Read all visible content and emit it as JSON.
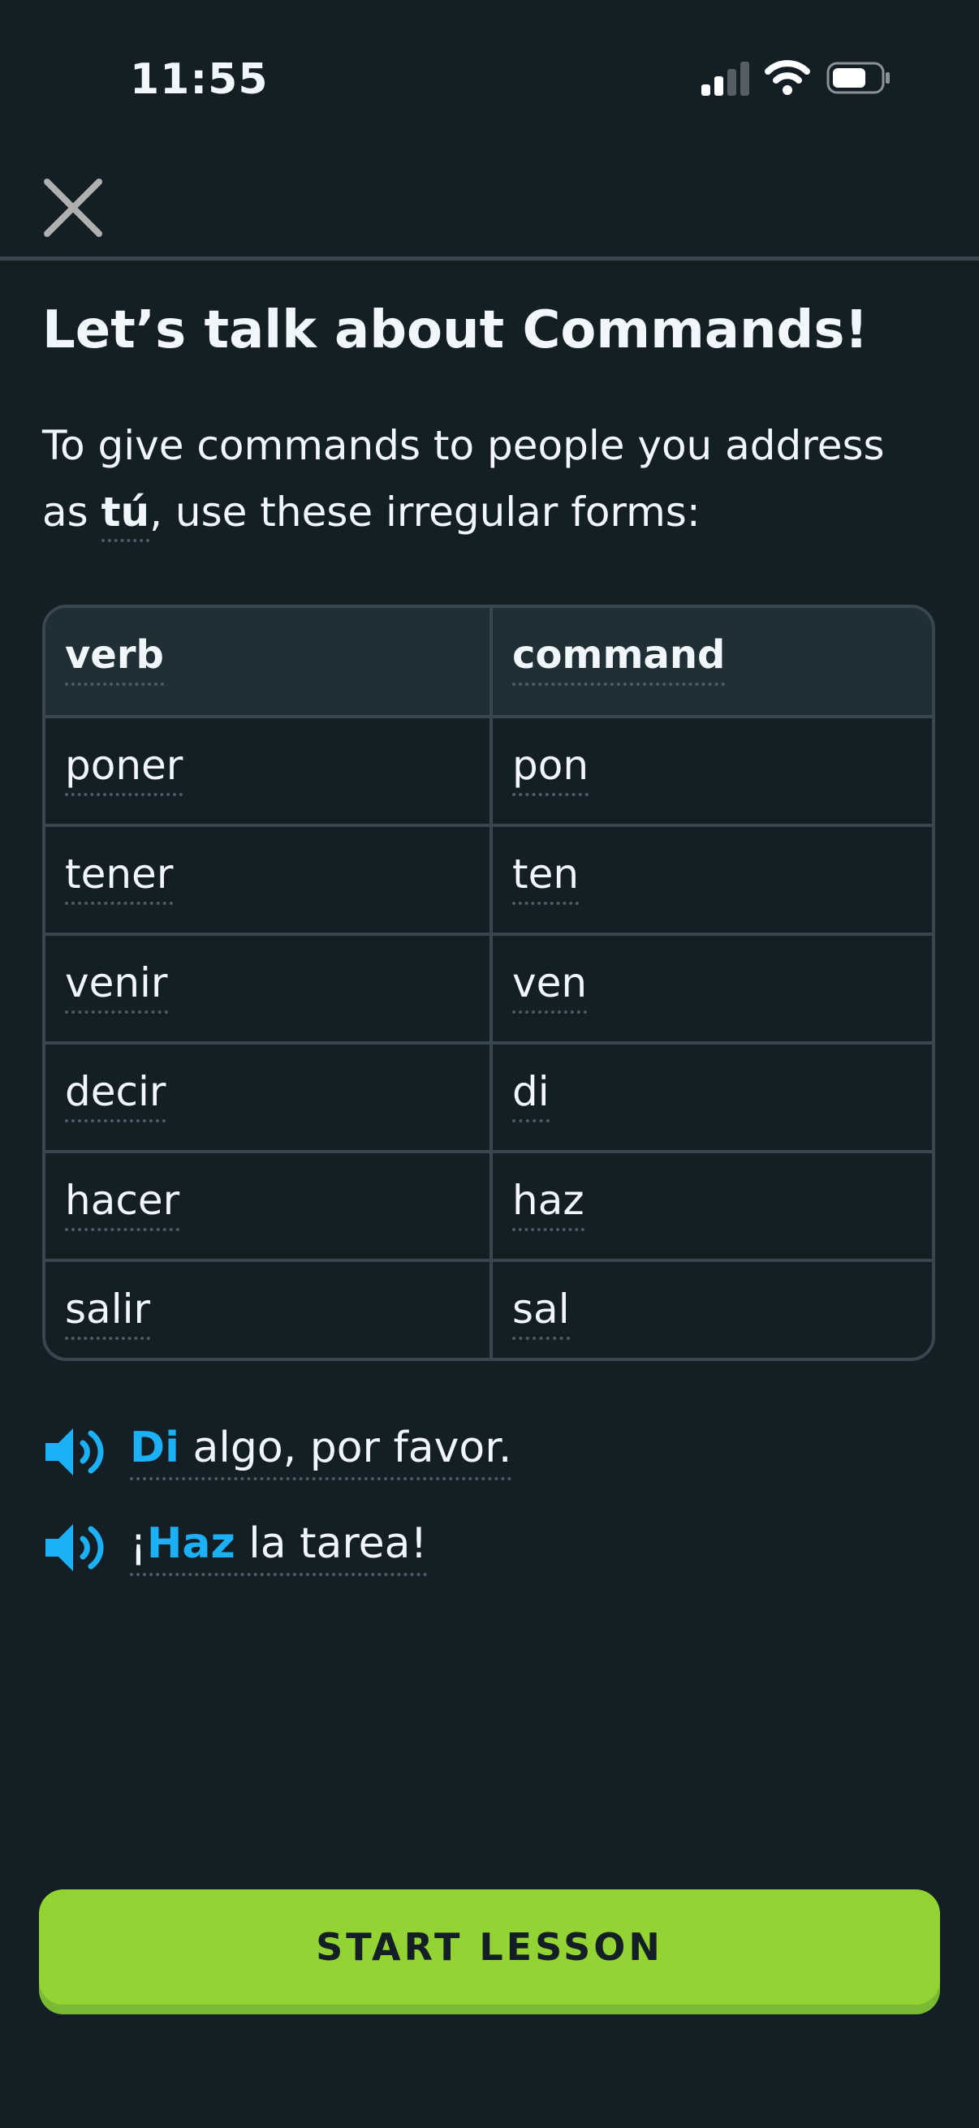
{
  "status_bar": {
    "time": "11:55"
  },
  "header": {
    "close_icon": "close-icon"
  },
  "lesson": {
    "title": "Let’s talk about Commands!",
    "intro_part1": "To give commands to people you address as ",
    "intro_emphasis": "tú",
    "intro_part2": ", use these irregular forms:"
  },
  "table": {
    "headers": [
      "verb",
      "command"
    ],
    "rows": [
      [
        "poner",
        "pon"
      ],
      [
        "tener",
        "ten"
      ],
      [
        "venir",
        "ven"
      ],
      [
        "decir",
        "di"
      ],
      [
        "hacer",
        "haz"
      ],
      [
        "salir",
        "sal"
      ]
    ]
  },
  "examples": [
    {
      "prefix": "",
      "highlight": "Di",
      "rest": " algo, por favor."
    },
    {
      "prefix": "¡",
      "highlight": "Haz",
      "rest": " la tarea!"
    }
  ],
  "footer": {
    "start_label": "START LESSON"
  },
  "colors": {
    "background": "#131f24",
    "accent_blue": "#1cb0f6",
    "button_green": "#93d333"
  }
}
